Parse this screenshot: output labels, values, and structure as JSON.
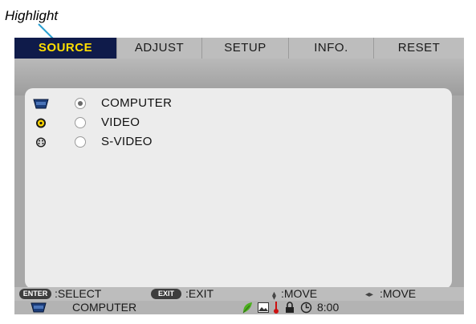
{
  "callout": {
    "text": "Highlight"
  },
  "tabs": [
    {
      "label": "SOURCE"
    },
    {
      "label": "ADJUST"
    },
    {
      "label": "SETUP"
    },
    {
      "label": "INFO."
    },
    {
      "label": "RESET"
    }
  ],
  "sources": [
    {
      "label": "COMPUTER",
      "icon": "computer-port-icon",
      "selected": true
    },
    {
      "label": "VIDEO",
      "icon": "video-jack-icon",
      "selected": false
    },
    {
      "label": "S-VIDEO",
      "icon": "s-video-jack-icon",
      "selected": false
    }
  ],
  "footer": {
    "enter_key": "ENTER",
    "enter_label": ":SELECT",
    "exit_key": "EXIT",
    "exit_label": ":EXIT",
    "move_vertical_label": ":MOVE",
    "move_horizontal_label": ":MOVE"
  },
  "status": {
    "source": "COMPUTER",
    "timer": "8:00"
  },
  "colors": {
    "active_tab_bg": "#0f1b4a",
    "active_tab_text": "#ffde00",
    "eco_green": "#4caf1f",
    "thermo_red": "#cc1111"
  }
}
